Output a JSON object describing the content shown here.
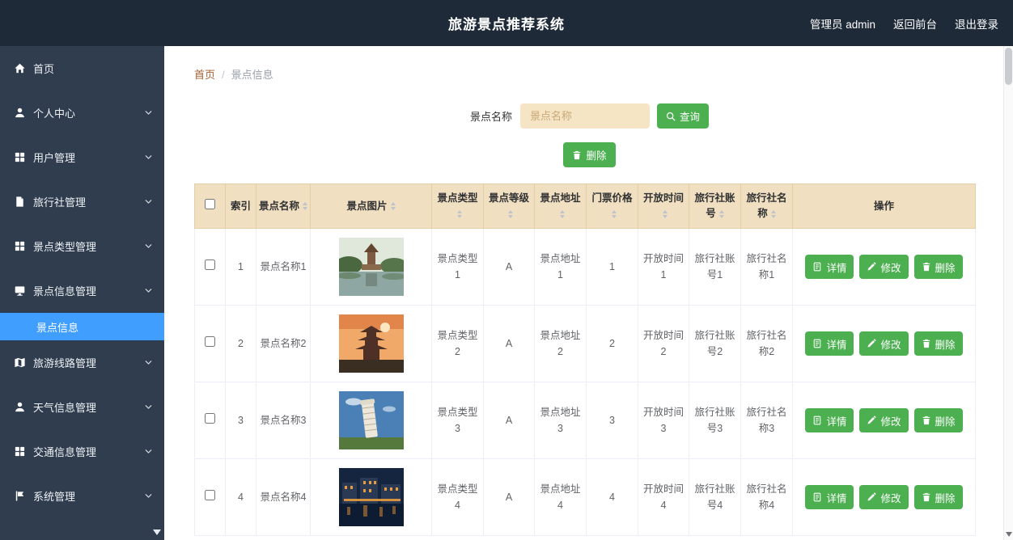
{
  "colors": {
    "topbar": "#1e2a38",
    "sidebar": "#2f3d4f",
    "accent_green": "#4caf50",
    "active_blue": "#409eff",
    "table_header_bg": "#f0dfc0",
    "input_bg": "#f5e5c4",
    "breadcrumb_home": "#a65e2e"
  },
  "header": {
    "title": "旅游景点推荐系统",
    "admin_label": "管理员 admin",
    "back_front_label": "返回前台",
    "logout_label": "退出登录"
  },
  "sidebar": {
    "items": [
      {
        "label": "首页",
        "icon": "home",
        "expandable": false
      },
      {
        "label": "个人中心",
        "icon": "user",
        "expandable": true
      },
      {
        "label": "用户管理",
        "icon": "grid",
        "expandable": true
      },
      {
        "label": "旅行社管理",
        "icon": "file",
        "expandable": true
      },
      {
        "label": "景点类型管理",
        "icon": "grid",
        "expandable": true
      },
      {
        "label": "景点信息管理",
        "icon": "monitor",
        "expandable": true,
        "expanded": true,
        "children": [
          {
            "label": "景点信息",
            "active": true
          }
        ]
      },
      {
        "label": "旅游线路管理",
        "icon": "map",
        "expandable": true
      },
      {
        "label": "天气信息管理",
        "icon": "user",
        "expandable": true
      },
      {
        "label": "交通信息管理",
        "icon": "grid",
        "expandable": true
      },
      {
        "label": "系统管理",
        "icon": "flag",
        "expandable": true
      }
    ]
  },
  "breadcrumb": {
    "home": "首页",
    "separator": "/",
    "current": "景点信息"
  },
  "search": {
    "label": "景点名称",
    "placeholder": "景点名称",
    "query_label": "查询",
    "delete_label": "删除"
  },
  "table": {
    "columns": [
      {
        "label": "索引",
        "sortable": false
      },
      {
        "label": "景点名称",
        "sortable": true
      },
      {
        "label": "景点图片",
        "sortable": true
      },
      {
        "label": "景点类型",
        "sortable": true
      },
      {
        "label": "景点等级",
        "sortable": true
      },
      {
        "label": "景点地址",
        "sortable": true
      },
      {
        "label": "门票价格",
        "sortable": true
      },
      {
        "label": "开放时间",
        "sortable": true
      },
      {
        "label": "旅行社账号",
        "sortable": true
      },
      {
        "label": "旅行社名称",
        "sortable": true
      },
      {
        "label": "操作",
        "sortable": false
      }
    ],
    "action_labels": {
      "detail": "详情",
      "edit": "修改",
      "delete": "删除"
    },
    "rows": [
      {
        "index": "1",
        "name": "景点名称1",
        "photo": "lake-pavilion",
        "type": "景点类型1",
        "grade": "A",
        "address": "景点地址1",
        "price": "1",
        "open_time": "开放时间1",
        "agency_account": "旅行社账号1",
        "agency_name": "旅行社名称1"
      },
      {
        "index": "2",
        "name": "景点名称2",
        "photo": "pagoda-sunset",
        "type": "景点类型2",
        "grade": "A",
        "address": "景点地址2",
        "price": "2",
        "open_time": "开放时间2",
        "agency_account": "旅行社账号2",
        "agency_name": "旅行社名称2"
      },
      {
        "index": "3",
        "name": "景点名称3",
        "photo": "pisa-tower",
        "type": "景点类型3",
        "grade": "A",
        "address": "景点地址3",
        "price": "3",
        "open_time": "开放时间3",
        "agency_account": "旅行社账号3",
        "agency_name": "旅行社名称3"
      },
      {
        "index": "4",
        "name": "景点名称4",
        "photo": "night-canal",
        "type": "景点类型4",
        "grade": "A",
        "address": "景点地址4",
        "price": "4",
        "open_time": "开放时间4",
        "agency_account": "旅行社账号4",
        "agency_name": "旅行社名称4"
      }
    ]
  }
}
